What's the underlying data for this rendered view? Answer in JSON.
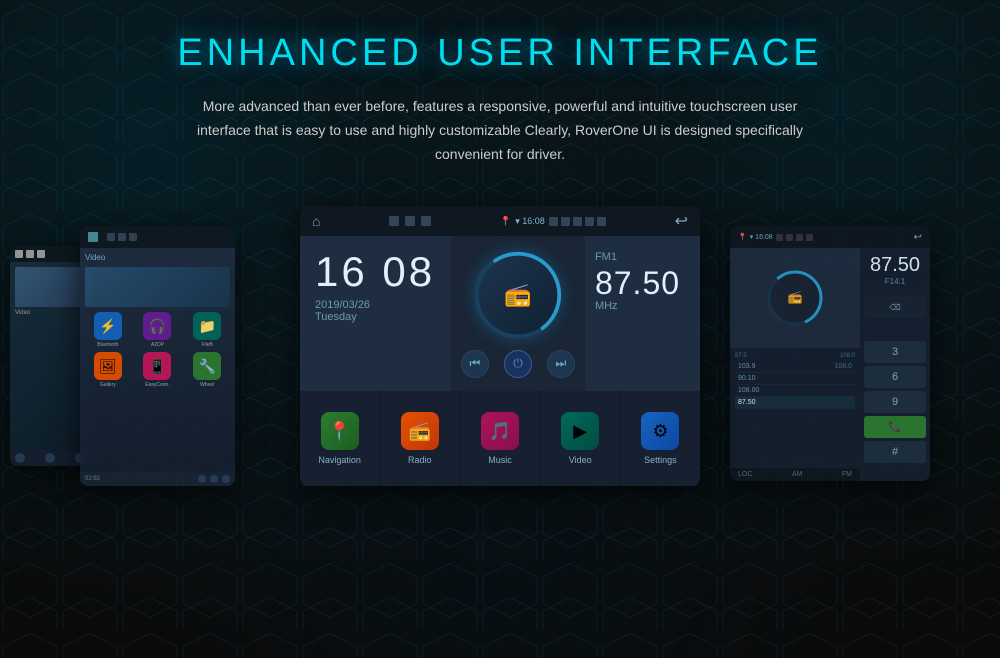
{
  "page": {
    "title": "ENHANCED USER INTERFACE",
    "subtitle": "More advanced than ever before, features a responsive, powerful and intuitive touchscreen user interface that is easy to use and highly customizable Clearly, RoverOne UI is designed specifically convenient for driver."
  },
  "center_screen": {
    "time": "16 08",
    "date": "2019/03/26",
    "day": "Tuesday",
    "fm_label": "FM1",
    "fm_freq": "87.50",
    "fm_mhz": "MHz",
    "apps": [
      {
        "name": "Navigation",
        "icon": "📍",
        "color_class": "nav-green"
      },
      {
        "name": "Radio",
        "icon": "📻",
        "color_class": "radio-orange"
      },
      {
        "name": "Music",
        "icon": "🎵",
        "color_class": "music-pink"
      },
      {
        "name": "Video",
        "icon": "▶",
        "color_class": "video-teal"
      },
      {
        "name": "Settings",
        "icon": "⚙",
        "color_class": "settings-blue"
      }
    ]
  },
  "left_screen": {
    "apps": [
      {
        "name": "Bluetooth",
        "icon": "⚡",
        "color_class": "bt-blue"
      },
      {
        "name": "A2DP",
        "icon": "🎧",
        "color_class": "a2dp-purple"
      },
      {
        "name": "FileB",
        "icon": "📁",
        "color_class": "file-teal"
      },
      {
        "name": "Gallery",
        "icon": "🖼",
        "color_class": "gallery-orange"
      },
      {
        "name": "EasyConn.",
        "icon": "📱",
        "color_class": "easy-pink"
      },
      {
        "name": "Wheel",
        "icon": "🔧",
        "color_class": "wheel-green"
      }
    ],
    "time_text": "02:92",
    "video_label": "Video"
  },
  "right_screen": {
    "freq_big": "87.50",
    "freq_label": "F14:1",
    "stations": [
      {
        "freq": "103.9",
        "name": "108.0",
        "active": false
      },
      {
        "freq": "90.10",
        "name": "",
        "active": false
      },
      {
        "freq": "108.00",
        "name": "",
        "active": false
      },
      {
        "freq": "87.50",
        "name": "",
        "active": true
      }
    ],
    "bottom": {
      "loc": "LOC",
      "am": "AM",
      "fm": "FM"
    },
    "numpad": [
      "3",
      "6",
      "9",
      "#"
    ],
    "back_label": "⌫"
  },
  "icons": {
    "home": "⌂",
    "back": "↩",
    "power": "⏻",
    "prev": "⏮",
    "next": "⏭",
    "location": "📍",
    "signal": "▲",
    "volume": "🔊",
    "phone": "📞"
  }
}
